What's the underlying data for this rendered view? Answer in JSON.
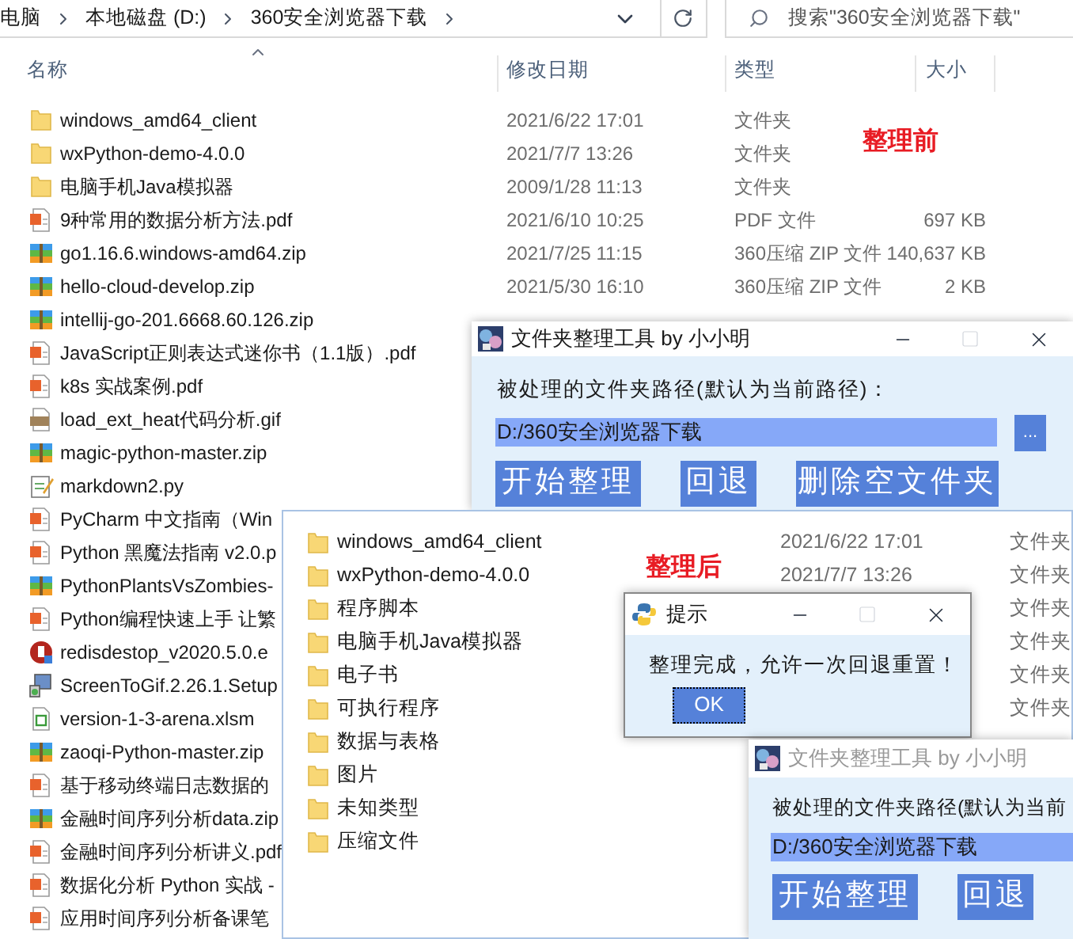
{
  "explorer": {
    "breadcrumb": [
      "电脑",
      "本地磁盘 (D:)",
      "360安全浏览器下载"
    ],
    "search": {
      "placeholder": "搜索\"360安全浏览器下载\""
    },
    "columns": [
      "名称",
      "修改日期",
      "类型",
      "大小"
    ],
    "annotation": "整理前",
    "files": [
      {
        "kind": "folder",
        "name": "windows_amd64_client",
        "date": "2021/6/22 17:01",
        "type": "文件夹"
      },
      {
        "kind": "folder",
        "name": "wxPython-demo-4.0.0",
        "date": "2021/7/7 13:26",
        "type": "文件夹"
      },
      {
        "kind": "folder",
        "name": "电脑手机Java模拟器",
        "date": "2009/1/28 11:13",
        "type": "文件夹"
      },
      {
        "kind": "pdf",
        "name": "9种常用的数据分析方法.pdf",
        "date": "2021/6/10 10:25",
        "type": "PDF 文件",
        "size": "697 KB"
      },
      {
        "kind": "zip",
        "name": "go1.16.6.windows-amd64.zip",
        "date": "2021/7/25 11:15",
        "type": "360压缩 ZIP 文件",
        "size": "140,637 KB"
      },
      {
        "kind": "zip",
        "name": "hello-cloud-develop.zip",
        "date": "2021/5/30 16:10",
        "type": "360压缩 ZIP 文件",
        "size": "2 KB"
      },
      {
        "kind": "zip",
        "name": "intellij-go-201.6668.60.126.zip"
      },
      {
        "kind": "pdf",
        "name": "JavaScript正则表达式迷你书（1.1版）.pdf"
      },
      {
        "kind": "pdf",
        "name": "k8s 实战案例.pdf"
      },
      {
        "kind": "gif",
        "name": "load_ext_heat代码分析.gif"
      },
      {
        "kind": "zip",
        "name": "magic-python-master.zip"
      },
      {
        "kind": "py",
        "name": "markdown2.py"
      },
      {
        "kind": "pdf",
        "name": "PyCharm 中文指南（Win"
      },
      {
        "kind": "pdf",
        "name": "Python 黑魔法指南 v2.0.p"
      },
      {
        "kind": "zip",
        "name": "PythonPlantsVsZombies-"
      },
      {
        "kind": "pdf",
        "name": "Python编程快速上手 让繁"
      },
      {
        "kind": "exe",
        "name": "redisdestop_v2020.5.0.e"
      },
      {
        "kind": "setup",
        "name": "ScreenToGif.2.26.1.Setup"
      },
      {
        "kind": "xlsm",
        "name": "version-1-3-arena.xlsm"
      },
      {
        "kind": "zip",
        "name": "zaoqi-Python-master.zip"
      },
      {
        "kind": "pdf",
        "name": "基于移动终端日志数据的"
      },
      {
        "kind": "zip",
        "name": "金融时间序列分析data.zip"
      },
      {
        "kind": "pdf",
        "name": "金融时间序列分析讲义.pdf"
      },
      {
        "kind": "pdf",
        "name": "数据化分析 Python 实战 -"
      },
      {
        "kind": "pdf",
        "name": "应用时间序列分析备课笔"
      }
    ]
  },
  "tool_window": {
    "title": "文件夹整理工具 by 小小明",
    "path_label": "被处理的文件夹路径(默认为当前路径)：",
    "path": "D:/360安全浏览器下载",
    "browse": "...",
    "buttons": [
      "开始整理",
      "回退",
      "删除空文件夹"
    ]
  },
  "after_window": {
    "annotation": "整理后",
    "folders": [
      {
        "name": "windows_amd64_client",
        "date": "2021/6/22 17:01",
        "type": "文件夹"
      },
      {
        "name": "wxPython-demo-4.0.0",
        "date": "2021/7/7 13:26",
        "type": "文件夹"
      },
      {
        "name": "程序脚本",
        "type": "文件夹"
      },
      {
        "name": "电脑手机Java模拟器",
        "type": "文件夹"
      },
      {
        "name": "电子书",
        "type": "文件夹"
      },
      {
        "name": "可执行程序",
        "type": "文件夹"
      },
      {
        "name": "数据与表格"
      },
      {
        "name": "图片"
      },
      {
        "name": "未知类型"
      },
      {
        "name": "压缩文件"
      }
    ]
  },
  "dialog": {
    "title": "提示",
    "message": "整理完成，允许一次回退重置！",
    "button": "OK"
  },
  "tool_window_2": {
    "title": "文件夹整理工具 by 小小明",
    "path_label": "被处理的文件夹路径(默认为当前",
    "path": "D:/360安全浏览器下载",
    "buttons": [
      "开始整理",
      "回退"
    ]
  }
}
